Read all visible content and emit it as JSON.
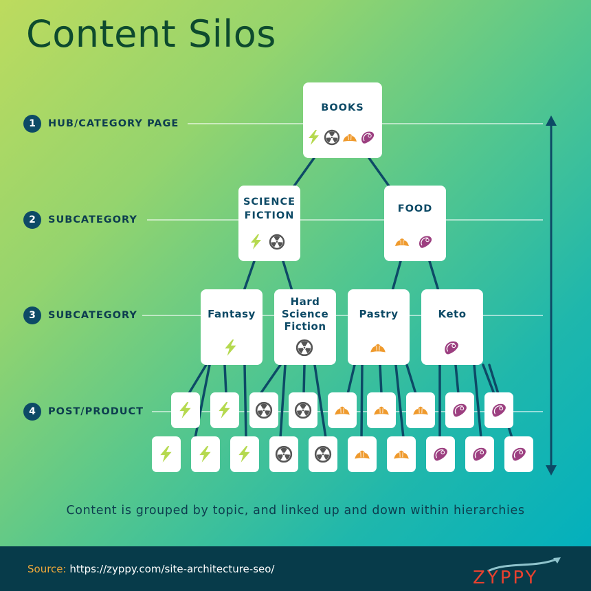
{
  "title": "Content Silos",
  "levels": [
    {
      "number": "1",
      "label": "HUB/CATEGORY PAGE"
    },
    {
      "number": "2",
      "label": "SUBCATEGORY"
    },
    {
      "number": "3",
      "label": "SUBCATEGORY"
    },
    {
      "number": "4",
      "label": "POST/PRODUCT"
    }
  ],
  "hub": {
    "label": "BOOKS",
    "icons": [
      "lightning-bolt-icon",
      "radiation-icon",
      "croissant-icon",
      "steak-icon"
    ]
  },
  "subcategories": [
    {
      "label": "SCIENCE FICTION",
      "lines": [
        "SCIENCE",
        "FICTION"
      ],
      "icons": [
        "lightning-bolt-icon",
        "radiation-icon"
      ]
    },
    {
      "label": "FOOD",
      "lines": [
        "FOOD"
      ],
      "icons": [
        "croissant-icon",
        "steak-icon"
      ]
    }
  ],
  "topics": [
    {
      "label": "Fantasy",
      "lines": [
        "Fantasy"
      ],
      "icon": "lightning-bolt-icon"
    },
    {
      "label": "Hard Science Fiction",
      "lines": [
        "Hard",
        "Science",
        "Fiction"
      ],
      "icon": "radiation-icon"
    },
    {
      "label": "Pastry",
      "lines": [
        "Pastry"
      ],
      "icon": "croissant-icon"
    },
    {
      "label": "Keto",
      "lines": [
        "Keto"
      ],
      "icon": "steak-icon"
    }
  ],
  "posts_row1": [
    "lightning-bolt-icon",
    "lightning-bolt-icon",
    "radiation-icon",
    "radiation-icon",
    "croissant-icon",
    "croissant-icon",
    "croissant-icon",
    "steak-icon",
    "steak-icon"
  ],
  "posts_row2": [
    "lightning-bolt-icon",
    "lightning-bolt-icon",
    "lightning-bolt-icon",
    "radiation-icon",
    "radiation-icon",
    "croissant-icon",
    "croissant-icon",
    "steak-icon",
    "steak-icon",
    "steak-icon"
  ],
  "caption": "Content is grouped by topic, and linked up and down within hierarchies",
  "footer": {
    "source_label": "Source:",
    "source_url": "https://zyppy.com/site-architecture-seo/",
    "logo_text": "ZYPPY"
  },
  "colors": {
    "navy": "#0d4a66",
    "bolt": "#b5d94f",
    "radiation": "#555555",
    "croissant": "#ef9a2d",
    "steak": "#9c3f80",
    "logo": "#e8412f",
    "footer_bg": "#073b4a"
  }
}
